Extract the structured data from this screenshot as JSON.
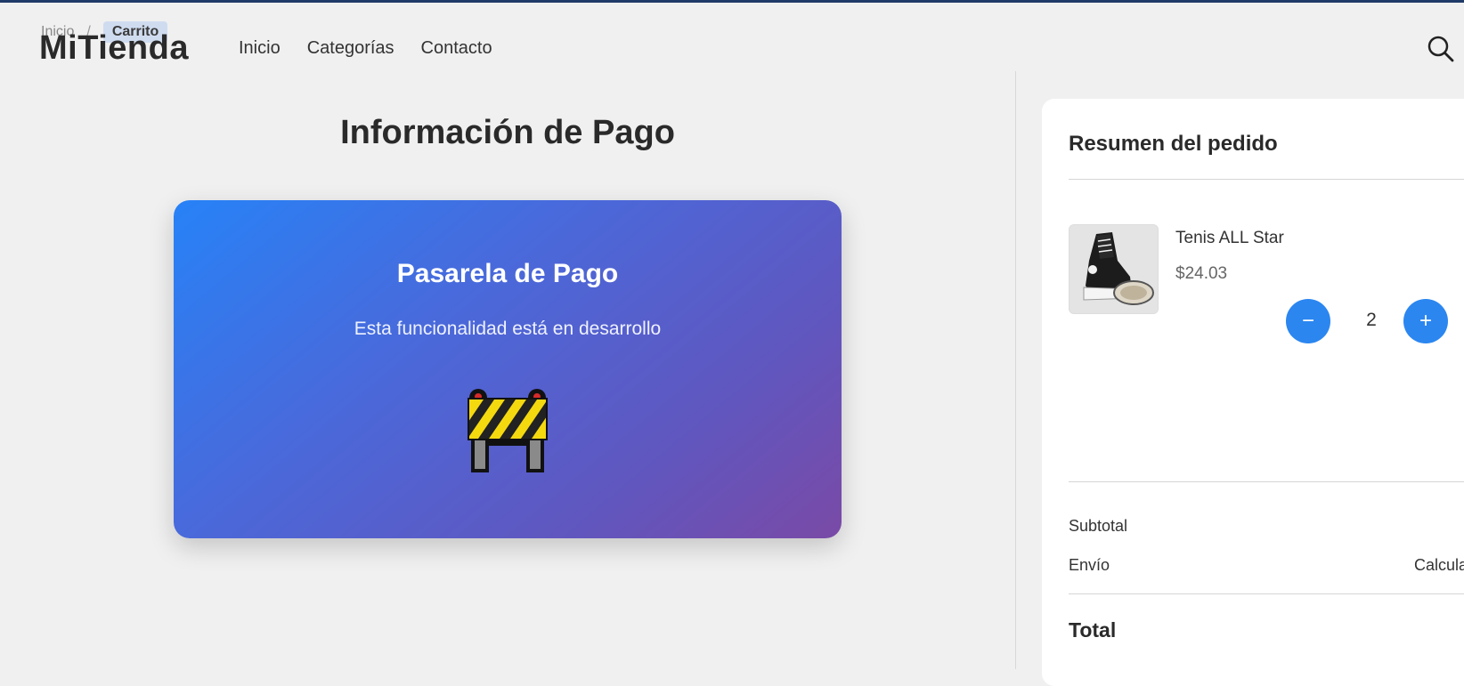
{
  "breadcrumb": {
    "home": "Inicio",
    "separator": "/",
    "current": "Carrito"
  },
  "header": {
    "logo": "MiTienda",
    "nav": [
      "Inicio",
      "Categorías",
      "Contacto"
    ],
    "search_icon": "search-icon"
  },
  "main": {
    "title": "Información de Pago",
    "payment_card": {
      "title": "Pasarela de Pago",
      "text": "Esta funcionalidad está en desarrollo",
      "icon": "construction-barrier-icon"
    }
  },
  "summary": {
    "title": "Resumen del pedido",
    "item": {
      "name": "Tenis ALL Star",
      "price": "$24.03",
      "quantity": "2",
      "decrement": "−",
      "increment": "+"
    },
    "subtotal_label": "Subtotal",
    "shipping_label": "Envío",
    "shipping_value": "Calcula",
    "total_label": "Total"
  },
  "colors": {
    "accent": "#2b86f0",
    "gradient_start": "#2782f7",
    "gradient_end": "#7a4aa6",
    "top_bar": "#1f3a68"
  }
}
